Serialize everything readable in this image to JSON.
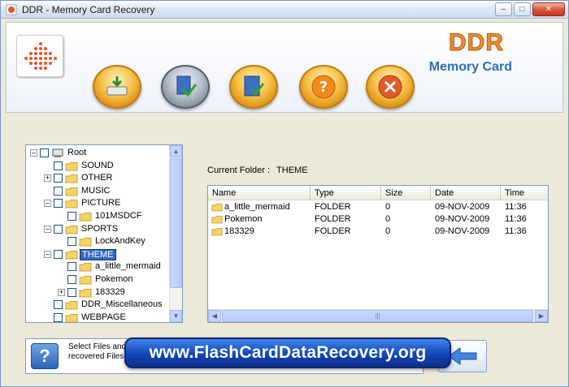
{
  "window": {
    "title": "DDR - Memory Card Recovery",
    "controls": {
      "minimize": "–",
      "maximize": "□",
      "close": "✕"
    }
  },
  "header": {
    "brand": "DDR",
    "subtitle": "Memory Card",
    "toolbar": [
      {
        "name": "open-drive-icon"
      },
      {
        "name": "save-recovered-icon"
      },
      {
        "name": "check-book-icon"
      },
      {
        "name": "help-icon"
      },
      {
        "name": "exit-icon"
      }
    ]
  },
  "tree": {
    "items": [
      {
        "label": "Root",
        "indent": 0,
        "expander": "–",
        "checkbox": true,
        "type": "drive"
      },
      {
        "label": "SOUND",
        "indent": 1,
        "expander": "",
        "checkbox": true,
        "type": "folder"
      },
      {
        "label": "OTHER",
        "indent": 1,
        "expander": "+",
        "checkbox": true,
        "type": "folder"
      },
      {
        "label": "MUSIC",
        "indent": 1,
        "expander": "",
        "checkbox": true,
        "type": "folder"
      },
      {
        "label": "PICTURE",
        "indent": 1,
        "expander": "–",
        "checkbox": true,
        "type": "folder"
      },
      {
        "label": "101MSDCF",
        "indent": 2,
        "expander": "",
        "checkbox": true,
        "type": "folder"
      },
      {
        "label": "SPORTS",
        "indent": 1,
        "expander": "–",
        "checkbox": true,
        "type": "folder"
      },
      {
        "label": "LockAndKey",
        "indent": 2,
        "expander": "",
        "checkbox": true,
        "type": "folder"
      },
      {
        "label": "THEME",
        "indent": 1,
        "expander": "–",
        "checkbox": true,
        "type": "folder",
        "selected": true
      },
      {
        "label": "a_little_mermaid",
        "indent": 2,
        "expander": "",
        "checkbox": true,
        "type": "folder"
      },
      {
        "label": "Pokemon",
        "indent": 2,
        "expander": "",
        "checkbox": true,
        "type": "folder"
      },
      {
        "label": "183329",
        "indent": 2,
        "expander": "+",
        "checkbox": true,
        "type": "folder"
      },
      {
        "label": "DDR_Miscellaneous",
        "indent": 1,
        "expander": "",
        "checkbox": true,
        "type": "folder"
      },
      {
        "label": "WEBPAGE",
        "indent": 1,
        "expander": "",
        "checkbox": true,
        "type": "folder"
      }
    ]
  },
  "current_folder": {
    "label": "Current Folder  :",
    "value": "THEME"
  },
  "file_list": {
    "columns": [
      "Name",
      "Type",
      "Size",
      "Date",
      "Time"
    ],
    "rows": [
      {
        "name": "a_little_mermaid",
        "type": "FOLDER",
        "size": "0",
        "date": "09-NOV-2009",
        "time": "11:36"
      },
      {
        "name": "Pokemon",
        "type": "FOLDER",
        "size": "0",
        "date": "09-NOV-2009",
        "time": "11:36"
      },
      {
        "name": "183329",
        "type": "FOLDER",
        "size": "0",
        "date": "09-NOV-2009",
        "time": "11:36"
      }
    ],
    "hscroll_grip": "|||"
  },
  "status": {
    "help_glyph": "?",
    "line1": "Select Files and",
    "line2": "recovered Files a"
  },
  "banner": "www.FlashCardDataRecovery.org",
  "colors": {
    "accent": "#316ac5",
    "brand": "#f28c28",
    "banner": "#1246b7"
  }
}
